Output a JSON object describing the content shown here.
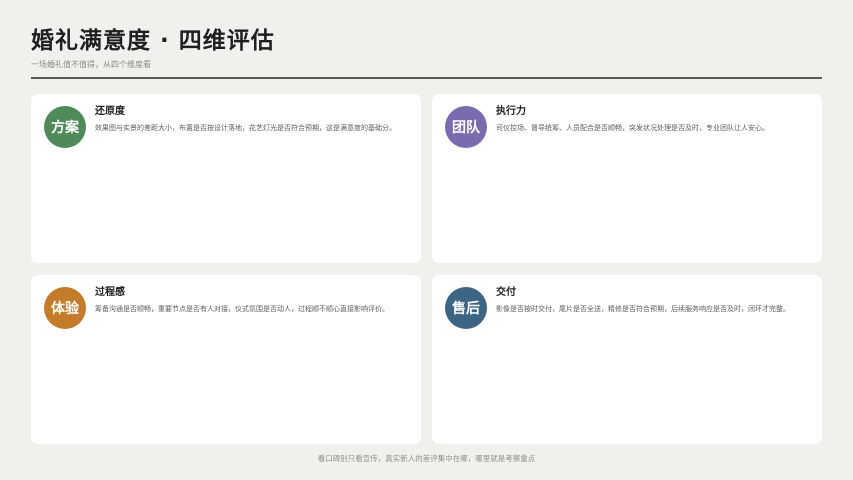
{
  "header": {
    "title": "婚礼满意度 · 四维评估",
    "subtitle": "一场婚礼值不值得，从四个维度看"
  },
  "cards": [
    {
      "badge": "方案",
      "badge_color": "#4e8a5a",
      "title": "还原度",
      "body": "效果图与实景的差距大小，布置是否按设计落地，花艺灯光是否符合预期，这是满意度的基础分。"
    },
    {
      "badge": "团队",
      "badge_color": "#7b6aae",
      "title": "执行力",
      "body": "司仪控场、督导统筹、人员配合是否顺畅，突发状况处理是否及时，专业团队让人安心。"
    },
    {
      "badge": "体验",
      "badge_color": "#c47c2a",
      "title": "过程感",
      "body": "筹备沟通是否顺畅，重要节点是否有人对接，仪式氛围是否动人，过程顺不顺心直接影响评价。"
    },
    {
      "badge": "售后",
      "badge_color": "#3c6584",
      "title": "交付",
      "body": "影像是否按时交付，尾片是否全送，精修是否符合预期，后续服务响应是否及时，闭环才完整。"
    }
  ],
  "footer": {
    "text": "看口碑别只看宣传，真实新人的差评集中在哪，哪里就是考察重点"
  }
}
